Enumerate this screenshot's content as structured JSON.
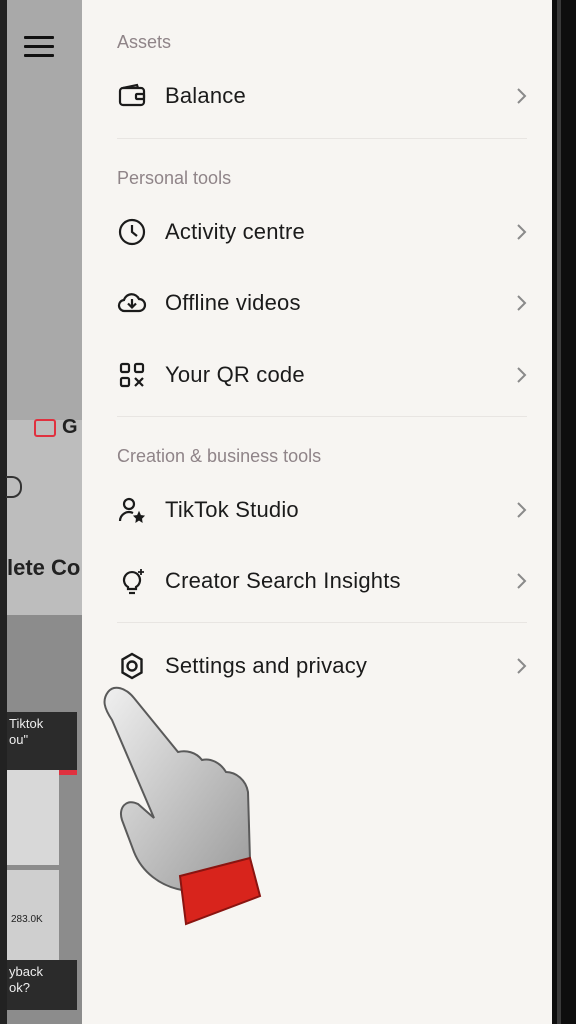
{
  "drawer": {
    "sections": [
      {
        "label": "Assets",
        "items": [
          {
            "label": "Balance",
            "icon": "wallet-icon"
          }
        ]
      },
      {
        "label": "Personal tools",
        "items": [
          {
            "label": "Activity centre",
            "icon": "clock-icon"
          },
          {
            "label": "Offline videos",
            "icon": "cloud-download-icon"
          },
          {
            "label": "Your QR code",
            "icon": "qr-code-icon"
          }
        ]
      },
      {
        "label": "Creation & business tools",
        "items": [
          {
            "label": "TikTok Studio",
            "icon": "user-star-icon"
          },
          {
            "label": "Creator Search Insights",
            "icon": "lightbulb-icon"
          }
        ]
      },
      {
        "label": "",
        "items": [
          {
            "label": "Settings and privacy",
            "icon": "gear-icon"
          }
        ]
      }
    ]
  },
  "background": {
    "visible_text_g": "G",
    "visible_text_lete": "lete Co",
    "thumb1_text": "Tiktok\nou\"",
    "thumb3_text": "283.0K",
    "thumb4_text": "yback\nok?"
  },
  "colors": {
    "drawer_bg": "#f7f5f2",
    "accent_red": "#e0313f",
    "label_gray": "#8f8488"
  }
}
